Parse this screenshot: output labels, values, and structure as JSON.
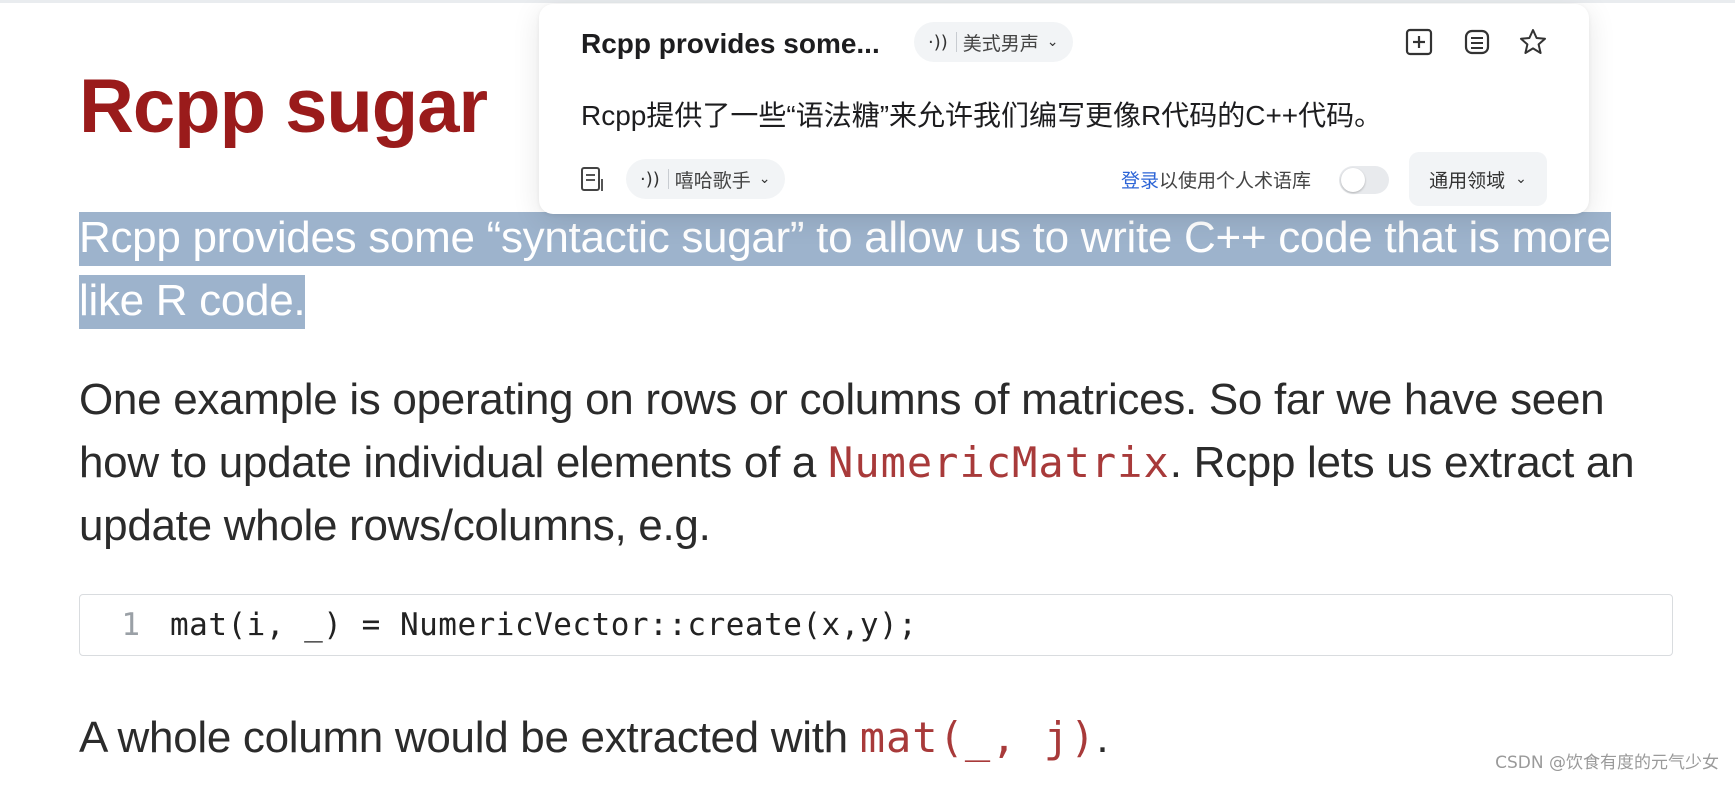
{
  "article": {
    "title": "Rcpp sugar",
    "highlighted_paragraph": "Rcpp provides some “syntactic sugar” to allow us to write C++ code that is more like R code.",
    "para2_part1": "One example is operating on rows or columns of matrices. So far we have seen how to update individual elements of a ",
    "para2_code": "NumericMatrix",
    "para2_part2": ". Rcpp lets us extract an update whole rows/columns, e.g.",
    "code_block": {
      "line_number": "1",
      "line": "mat(i, _) = NumericVector::create(x,y);"
    },
    "para3_part1": "A whole column would be extracted with ",
    "para3_code": "mat(_, j)",
    "para3_part2": "."
  },
  "popup": {
    "source_title": "Rcpp provides some...",
    "source_voice": "美式男声",
    "translation": "Rcpp提供了一些“语法糖”来允许我们编写更像R代码的C++代码。",
    "target_voice": "嘻哈歌手",
    "login_link": "登录",
    "login_suffix": "以使用个人术语库",
    "personal_glossary_enabled": false,
    "domain": "通用领域",
    "icons": {
      "speaker": "speaker-icon",
      "add": "add-icon",
      "copy": "copy-icon",
      "star": "star-icon",
      "document": "document-icon",
      "chevron": "chevron-down-icon"
    }
  },
  "watermark": "CSDN @饮食有度的元气少女",
  "colors": {
    "title": "#9a1b1b",
    "highlight": "#9db3cc",
    "inline_code": "#a83a3a",
    "link": "#2c64d6"
  }
}
